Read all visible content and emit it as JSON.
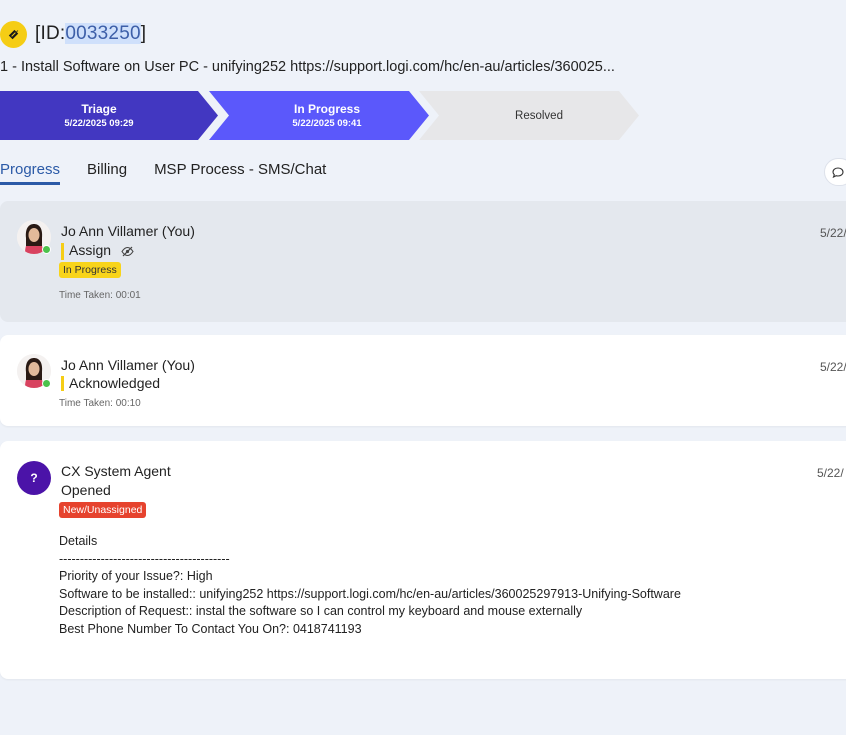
{
  "header": {
    "id_prefix": "[ID:",
    "id_number": "0033250",
    "id_suffix": "]",
    "subject": "1 - Install Software on User PC - unifying252 https://support.logi.com/hc/en-au/articles/360025..."
  },
  "stages": [
    {
      "label": "Triage",
      "datetime": "5/22/2025 09:29"
    },
    {
      "label": "In Progress",
      "datetime": "5/22/2025 09:41"
    },
    {
      "label": "Resolved",
      "datetime": ""
    }
  ],
  "tabs": [
    {
      "label": "Progress",
      "active": true
    },
    {
      "label": "Billing",
      "active": false
    },
    {
      "label": "MSP Process - SMS/Chat",
      "active": false
    }
  ],
  "activities": [
    {
      "name": "Jo Ann Villamer (You)",
      "action": "Assign",
      "badge": "In Progress",
      "time_taken": "Time Taken: 00:01",
      "date": "5/22/"
    },
    {
      "name": "Jo Ann Villamer (You)",
      "action": "Acknowledged",
      "time_taken": "Time Taken: 00:10",
      "date": "5/22/"
    },
    {
      "name": "CX System Agent",
      "avatar_initial": "?",
      "action": "Opened",
      "badge": "New/Unassigned",
      "date": "5/22/",
      "details": [
        "Details",
        "-----------------------------------------",
        "Priority of your Issue?: High",
        "Software to be installed:: unifying252 https://support.logi.com/hc/en-au/articles/360025297913-Unifying-Software",
        "Description of Request:: instal the software so I can control my keyboard and mouse externally",
        "Best Phone Number To Contact You On?: 0418741193"
      ]
    }
  ],
  "colors": {
    "accent": "#2b5aa7",
    "triage": "#4237c1",
    "in_progress": "#5b58fb",
    "badge_yellow": "#f8d41a",
    "badge_red": "#e6432e",
    "online": "#4cc24c"
  }
}
